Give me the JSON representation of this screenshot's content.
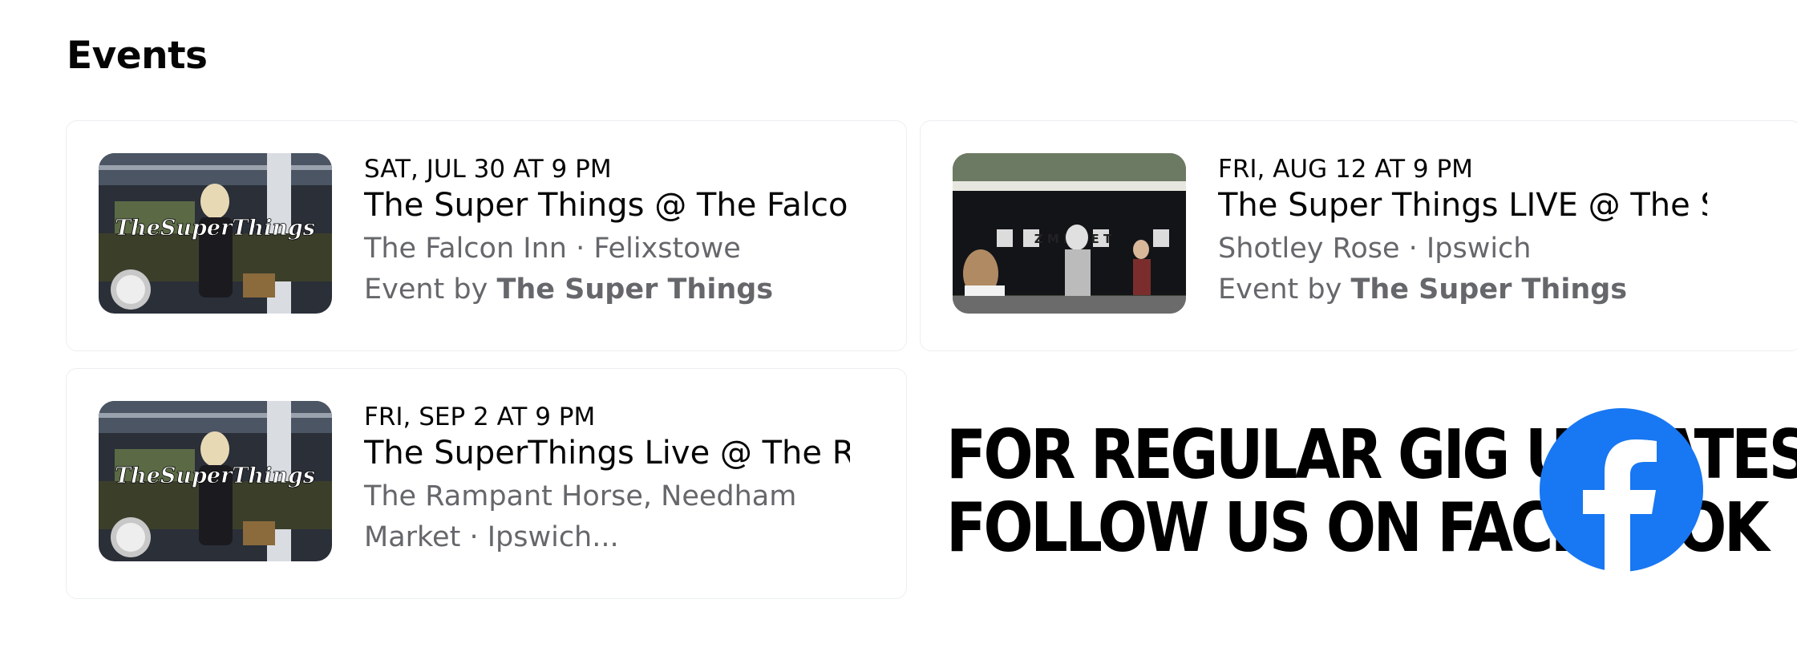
{
  "section": {
    "title": "Events"
  },
  "events": [
    {
      "date": "SAT, JUL 30 AT 9 PM",
      "name": "The Super Things @ The Falcon",
      "location": "The Falcon Inn · Felixstowe",
      "event_by_prefix": "Event by ",
      "host": "The Super Things",
      "thumb_text": "TheSuperThings"
    },
    {
      "date": "FRI, AUG 12 AT 9 PM",
      "name": "The Super Things LIVE @ The Sl",
      "location": "Shotley Rose · Ipswich",
      "event_by_prefix": "Event by ",
      "host": "The Super Things",
      "thumb_text": "Z M R H E T"
    },
    {
      "date": "FRI, SEP 2 AT 9 PM",
      "name": "The SuperThings Live @ The Ra",
      "location_line1": "The Rampant Horse, Needham",
      "location_line2": "Market · Ipswich...",
      "thumb_text": "TheSuperThings"
    }
  ],
  "promo": {
    "line1": "FOR REGULAR GIG UPDATES",
    "line2": "FOLLOW US ON FACEBOOK",
    "icon": "facebook-icon",
    "brand_color": "#1877f2"
  }
}
